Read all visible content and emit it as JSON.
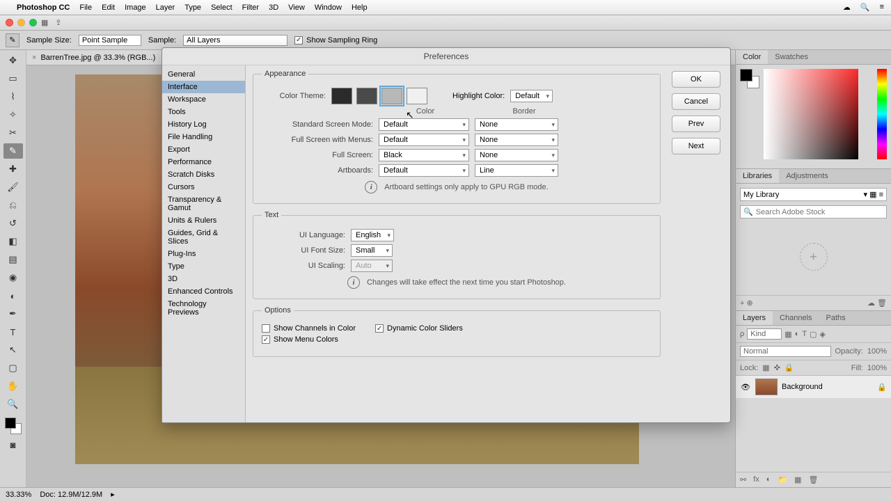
{
  "menubar": {
    "apple": "",
    "app": "Photoshop CC",
    "items": [
      "File",
      "Edit",
      "Image",
      "Layer",
      "Type",
      "Select",
      "Filter",
      "3D",
      "View",
      "Window",
      "Help"
    ]
  },
  "titlebar_right": [
    "☁",
    "🔍",
    "≡"
  ],
  "options_bar": {
    "sample_size_label": "Sample Size:",
    "sample_size_value": "Point Sample",
    "sample_label": "Sample:",
    "sample_value": "All Layers",
    "show_ring_label": "Show Sampling Ring"
  },
  "document": {
    "tab_title": "BarrenTree.jpg @ 33.3% (RGB...)"
  },
  "right": {
    "color_tab": "Color",
    "swatches_tab": "Swatches",
    "libraries_tab": "Libraries",
    "adjustments_tab": "Adjustments",
    "lib_select": "My Library",
    "lib_search_ph": "Search Adobe Stock",
    "layers_tab": "Layers",
    "channels_tab": "Channels",
    "paths_tab": "Paths",
    "kind_label": "Kind",
    "blend_mode": "Normal",
    "opacity_label": "Opacity:",
    "opacity_val": "100%",
    "lock_label": "Lock:",
    "fill_label": "Fill:",
    "fill_val": "100%",
    "layer_name": "Background"
  },
  "statusbar": {
    "zoom": "33.33%",
    "doc": "Doc: 12.9M/12.9M"
  },
  "dialog": {
    "title": "Preferences",
    "categories": [
      "General",
      "Interface",
      "Workspace",
      "Tools",
      "History Log",
      "File Handling",
      "Export",
      "Performance",
      "Scratch Disks",
      "Cursors",
      "Transparency & Gamut",
      "Units & Rulers",
      "Guides, Grid & Slices",
      "Plug-Ins",
      "Type",
      "3D",
      "Enhanced Controls",
      "Technology Previews"
    ],
    "active_category_index": 1,
    "buttons": {
      "ok": "OK",
      "cancel": "Cancel",
      "prev": "Prev",
      "next": "Next"
    },
    "appearance": {
      "legend": "Appearance",
      "color_theme_label": "Color Theme:",
      "swatch_colors": [
        "#2b2b2b",
        "#4a4a4a",
        "#b8b8b8",
        "#f0f0f0"
      ],
      "selected_swatch": 2,
      "highlight_label": "Highlight Color:",
      "highlight_value": "Default",
      "col_color": "Color",
      "col_border": "Border",
      "rows": [
        {
          "label": "Standard Screen Mode:",
          "color": "Default",
          "border": "None"
        },
        {
          "label": "Full Screen with Menus:",
          "color": "Default",
          "border": "None"
        },
        {
          "label": "Full Screen:",
          "color": "Black",
          "border": "None"
        },
        {
          "label": "Artboards:",
          "color": "Default",
          "border": "Line"
        }
      ],
      "info": "Artboard settings only apply to GPU RGB mode."
    },
    "text": {
      "legend": "Text",
      "rows": [
        {
          "label": "UI Language:",
          "value": "English",
          "disabled": false
        },
        {
          "label": "UI Font Size:",
          "value": "Small",
          "disabled": false
        },
        {
          "label": "UI Scaling:",
          "value": "Auto",
          "disabled": true
        }
      ],
      "info": "Changes will take effect the next time you start Photoshop."
    },
    "options": {
      "legend": "Options",
      "checks": [
        {
          "label": "Show Channels in Color",
          "checked": false
        },
        {
          "label": "Dynamic Color Sliders",
          "checked": true
        },
        {
          "label": "Show Menu Colors",
          "checked": true
        }
      ]
    }
  },
  "tools": [
    "↕",
    "▭",
    "◯",
    "◈",
    "✂",
    "✎",
    "✐",
    "◔",
    "✜",
    "ℒ",
    "⟋",
    "△",
    "◯",
    "✎",
    "T",
    "↖",
    "✋",
    "🔍"
  ]
}
